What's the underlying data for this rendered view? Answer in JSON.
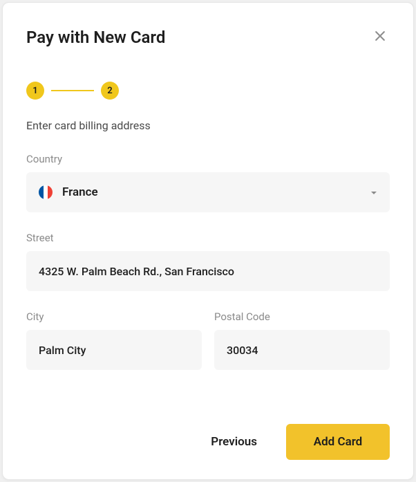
{
  "title": "Pay with New Card",
  "stepper": {
    "step1": "1",
    "step2": "2"
  },
  "instruction": "Enter card billing address",
  "fields": {
    "country": {
      "label": "Country",
      "value": "France"
    },
    "street": {
      "label": "Street",
      "value": "4325 W. Palm Beach Rd., San Francisco"
    },
    "city": {
      "label": "City",
      "value": "Palm City"
    },
    "postal": {
      "label": "Postal Code",
      "value": "30034"
    }
  },
  "buttons": {
    "previous": "Previous",
    "add_card": "Add Card"
  }
}
